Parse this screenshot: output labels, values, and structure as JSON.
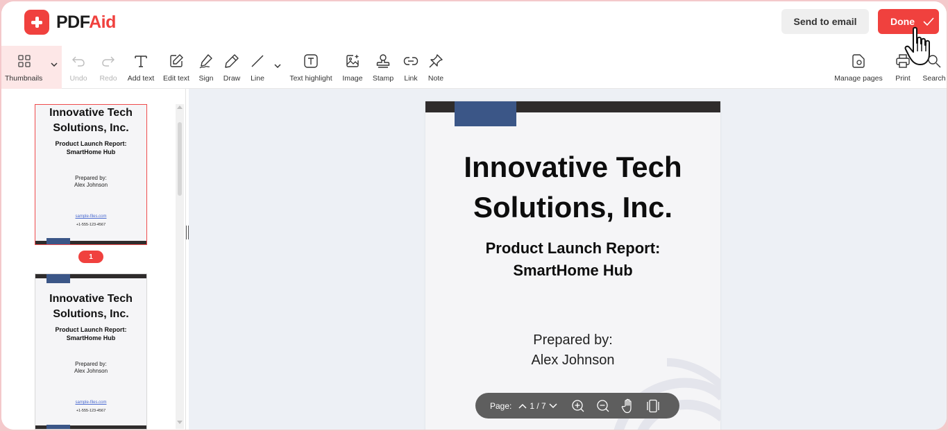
{
  "brand": {
    "name_part1": "PDF",
    "name_part2": "Aid",
    "accent": "#f0413e"
  },
  "header": {
    "send_email_label": "Send to email",
    "done_label": "Done"
  },
  "toolbar": {
    "thumbnails": "Thumbnails",
    "undo": "Undo",
    "redo": "Redo",
    "add_text": "Add text",
    "edit_text": "Edit text",
    "sign": "Sign",
    "draw": "Draw",
    "line": "Line",
    "text_highlight": "Text highlight",
    "image": "Image",
    "stamp": "Stamp",
    "link": "Link",
    "note": "Note",
    "manage_pages": "Manage pages",
    "print": "Print",
    "search": "Search"
  },
  "document": {
    "title_line1": "Innovative Tech",
    "title_line2": "Solutions, Inc.",
    "subtitle_line1": "Product Launch Report:",
    "subtitle_line2": "SmartHome Hub",
    "prepared_label": "Prepared by:",
    "author": "Alex Johnson",
    "link": "sample-files.com",
    "phone": "+1-555-123-4567"
  },
  "sidebar": {
    "current_page_badge": "1"
  },
  "pager": {
    "label": "Page:",
    "indicator": "1 / 7"
  }
}
